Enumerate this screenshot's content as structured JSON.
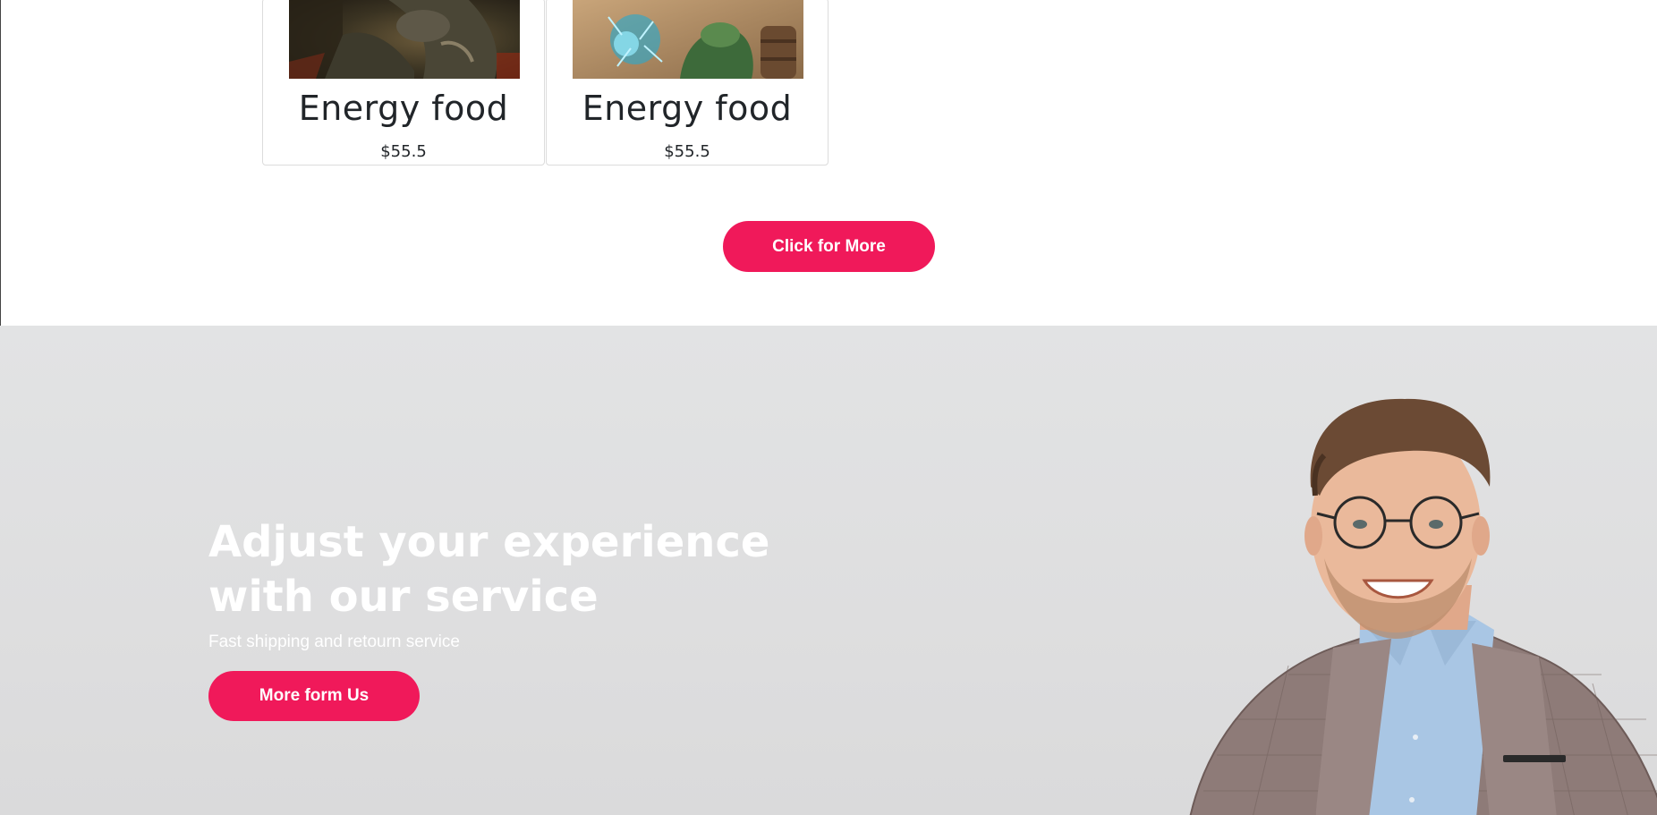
{
  "products": [
    {
      "title": "Energy food",
      "price": "$55.5",
      "image": "warrior-character-artwork"
    },
    {
      "title": "Energy food",
      "price": "$55.5",
      "image": "mage-character-artwork"
    }
  ],
  "more_button": {
    "label": "Click for More"
  },
  "banner": {
    "title": "Adjust your experience with our service",
    "subtitle": "Fast shipping and retourn service",
    "button_label": "More form Us",
    "image": "smiling-man-with-glasses-photo"
  },
  "colors": {
    "accent": "#f0195a",
    "banner_bg": "#e0e1e2",
    "text": "#212529"
  }
}
